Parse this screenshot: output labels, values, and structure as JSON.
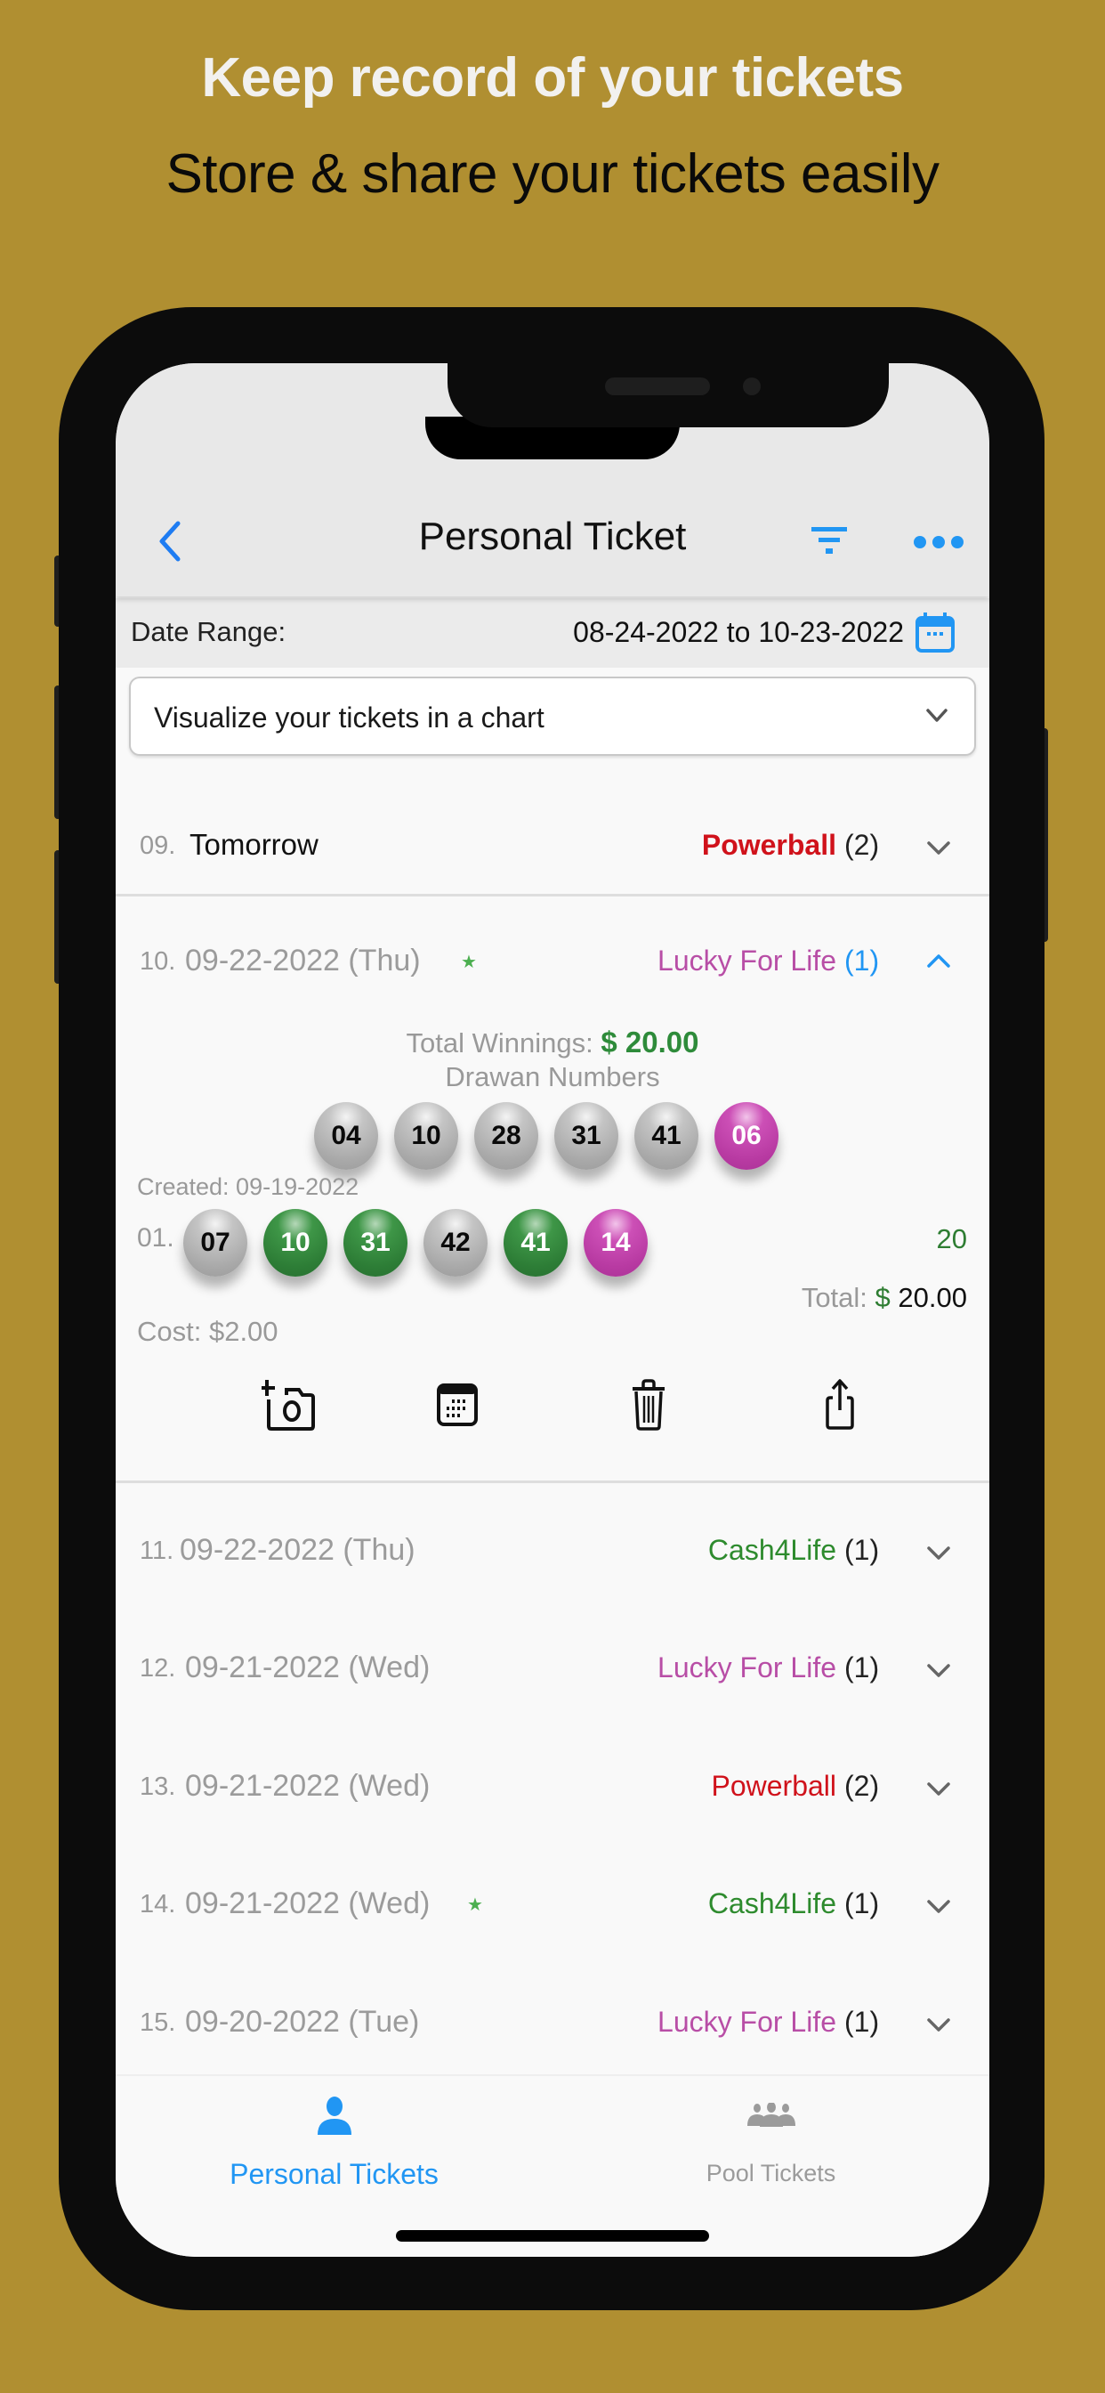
{
  "promo": {
    "headline": "Keep record of your tickets",
    "subheadline": "Store & share your tickets easily"
  },
  "colors": {
    "background": "#B08F31",
    "accent": "#2196F3",
    "powerball": "#D0121B",
    "lucky_for_life": "#B84EA6",
    "cash4life": "#2E7D32",
    "winnings": "#2E8B3A"
  },
  "navbar": {
    "title": "Personal Ticket",
    "back_icon": "chevron-left-icon",
    "filter_icon": "filter-icon",
    "more_icon": "ellipsis-icon"
  },
  "date_range": {
    "label": "Date Range:",
    "value": "08-24-2022 to 10-23-2022",
    "icon": "calendar-icon"
  },
  "chart_dropdown": {
    "label": "Visualize your tickets in a chart"
  },
  "tickets": [
    {
      "index": "09.",
      "date": "Tomorrow",
      "game": "Powerball",
      "count": "(2)",
      "starred": false,
      "expanded": false
    },
    {
      "index": "10.",
      "date": "09-22-2022 (Thu)",
      "game": "Lucky For Life",
      "count": "(1)",
      "starred": true,
      "expanded": true
    },
    {
      "index": "11.",
      "date": "09-22-2022 (Thu)",
      "game": "Cash4Life",
      "count": "(1)",
      "starred": false,
      "expanded": false
    },
    {
      "index": "12.",
      "date": "09-21-2022 (Wed)",
      "game": "Lucky For Life",
      "count": "(1)",
      "starred": false,
      "expanded": false
    },
    {
      "index": "13.",
      "date": "09-21-2022 (Wed)",
      "game": "Powerball",
      "count": "(2)",
      "starred": false,
      "expanded": false
    },
    {
      "index": "14.",
      "date": "09-21-2022 (Wed)",
      "game": "Cash4Life",
      "count": "(1)",
      "starred": true,
      "expanded": false
    },
    {
      "index": "15.",
      "date": "09-20-2022 (Tue)",
      "game": "Lucky For Life",
      "count": "(1)",
      "starred": false,
      "expanded": false
    }
  ],
  "expanded_ticket": {
    "total_winnings_label": "Total Winnings:",
    "total_winnings_value": "$ 20.00",
    "drawn_label": "Drawan Numbers",
    "drawn_numbers": [
      {
        "n": "04",
        "color": "gray"
      },
      {
        "n": "10",
        "color": "gray"
      },
      {
        "n": "28",
        "color": "gray"
      },
      {
        "n": "31",
        "color": "gray"
      },
      {
        "n": "41",
        "color": "gray"
      },
      {
        "n": "06",
        "color": "pink"
      }
    ],
    "created_label": "Created: 09-19-2022",
    "lines": [
      {
        "index": "01.",
        "numbers": [
          {
            "n": "07",
            "color": "gray"
          },
          {
            "n": "10",
            "color": "green"
          },
          {
            "n": "31",
            "color": "green"
          },
          {
            "n": "42",
            "color": "gray"
          },
          {
            "n": "41",
            "color": "green"
          },
          {
            "n": "14",
            "color": "pink"
          }
        ],
        "winnings": "20"
      }
    ],
    "total_label": "Total:",
    "total_dollar": "$",
    "total_value": "20.00",
    "cost": "Cost: $2.00",
    "actions": [
      "add-photo-icon",
      "calendar-icon",
      "trash-icon",
      "share-icon"
    ]
  },
  "tabbar": {
    "tabs": [
      {
        "label": "Personal Tickets",
        "icon": "person-icon",
        "active": true
      },
      {
        "label": "Pool Tickets",
        "icon": "group-icon",
        "active": false
      }
    ]
  }
}
